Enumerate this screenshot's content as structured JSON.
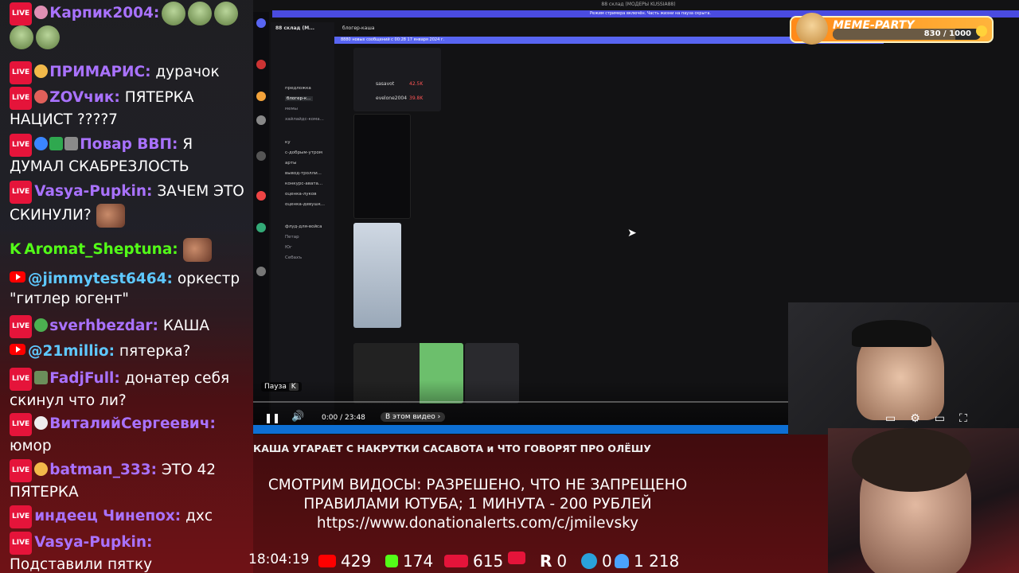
{
  "chat": {
    "messages": [
      {
        "platform": "live",
        "user": "Карпик2004:",
        "user_color": "#a972ff",
        "text": ""
      },
      {
        "platform": "live",
        "user": "ПРИМАРИС:",
        "user_color": "#a972ff",
        "text": "дурачок"
      },
      {
        "platform": "live",
        "user": "ZOVчик:",
        "user_color": "#a972ff",
        "text": "ПЯТЕРКА НАЦИСТ ????7"
      },
      {
        "platform": "live",
        "user": "Повар ВВП:",
        "user_color": "#a972ff",
        "text": "Я ДУМАЛ СКАБРЕЗЛОСТЬ"
      },
      {
        "platform": "live",
        "user": "Vasya-Pupkin:",
        "user_color": "#a972ff",
        "text": "ЗАЧЕМ ЭТО СКИНУЛИ?"
      },
      {
        "platform": "kick",
        "user": "Aromat_Sheptuna:",
        "user_color": "#53fc18",
        "text": ""
      },
      {
        "platform": "youtube",
        "user": "@jimmytest6464:",
        "user_color": "#5ec8ff",
        "text": "оркестр \"гитлер югент\""
      },
      {
        "platform": "live",
        "user": "sverhbezdar:",
        "user_color": "#a972ff",
        "text": "КАША"
      },
      {
        "platform": "youtube",
        "user": "@21millio:",
        "user_color": "#5ec8ff",
        "text": "пятерка?"
      },
      {
        "platform": "live",
        "user": "FadjFull:",
        "user_color": "#a972ff",
        "text": "донатер себя скинул что ли?"
      },
      {
        "platform": "live",
        "user": "ВиталийСергеевич:",
        "user_color": "#a972ff",
        "text": "юмор"
      },
      {
        "platform": "live",
        "user": "batman_333:",
        "user_color": "#a972ff",
        "text": "ЭТО 42 ПЯТЕРКА"
      },
      {
        "platform": "live",
        "user": "индеец Чинепох:",
        "user_color": "#a972ff",
        "text": "дхс"
      },
      {
        "platform": "live",
        "user": "Vasya-Pupkin:",
        "user_color": "#a972ff",
        "text": "Подставили пятку"
      }
    ],
    "live_badge": "LIVE",
    "kick_badge": "K"
  },
  "share": {
    "window_title": "88 склад (МОДЕРЫ KUSSIA88)",
    "notice_text": "Режим стримера включён. Часть жизни на пауза скрыта.",
    "server_name": "88 склад (М...",
    "channel_header": "блогер-каша",
    "new_messages": "8880 новых сообщений с 00:28 17 января 2024 г.",
    "channels": [
      "предложка",
      "блогер-к...",
      "мемы",
      "хайлайдс-кома...",
      "ку",
      "с-добрым-утром",
      "арты",
      "вывод-тролли...",
      "конкурс-авата...",
      "оценка-луков",
      "оценка-девушк...",
      "флуд-для-войса",
      "Петар",
      "Юг",
      "Себахъ"
    ],
    "players": [
      {
        "name": "sasavot",
        "stat": "42.5K"
      },
      {
        "name": "evelone2004",
        "stat": "39.8K"
      }
    ],
    "pause_label": "Пауза",
    "pause_key": "K",
    "time": "0:00 / 23:48",
    "in_video": "В этом видео"
  },
  "meme_party": {
    "label": "MEME-PARTY",
    "progress": "830 / 1000",
    "progress_fraction": 0.83
  },
  "overlay": {
    "video_title": "КАША УГАРАЕТ С НАКРУТКИ САСАВОТА и ЧТО ГОВОРЯТ ПРО ОЛЁШУ",
    "rules_line1": "СМОТРИМ ВИДОСЫ: РАЗРЕШЕНО, ЧТО НЕ ЗАПРЕЩЕНО",
    "rules_line2": "ПРАВИЛАМИ ЮТУБА; 1 МИНУТА - 200 РУБЛЕЙ",
    "donation_url": "https://www.donationalerts.com/c/jmilevsky"
  },
  "stats": {
    "clock": "18:04:19",
    "youtube": "429",
    "kick": "174",
    "live": "615",
    "rutube": "0",
    "telegram": "0",
    "total": "1 218"
  },
  "colors": {
    "live_red": "#e5143a",
    "kick_green": "#53fc18",
    "discord_blue": "#5865f2",
    "taskbar_blue": "#0d6fd3"
  }
}
